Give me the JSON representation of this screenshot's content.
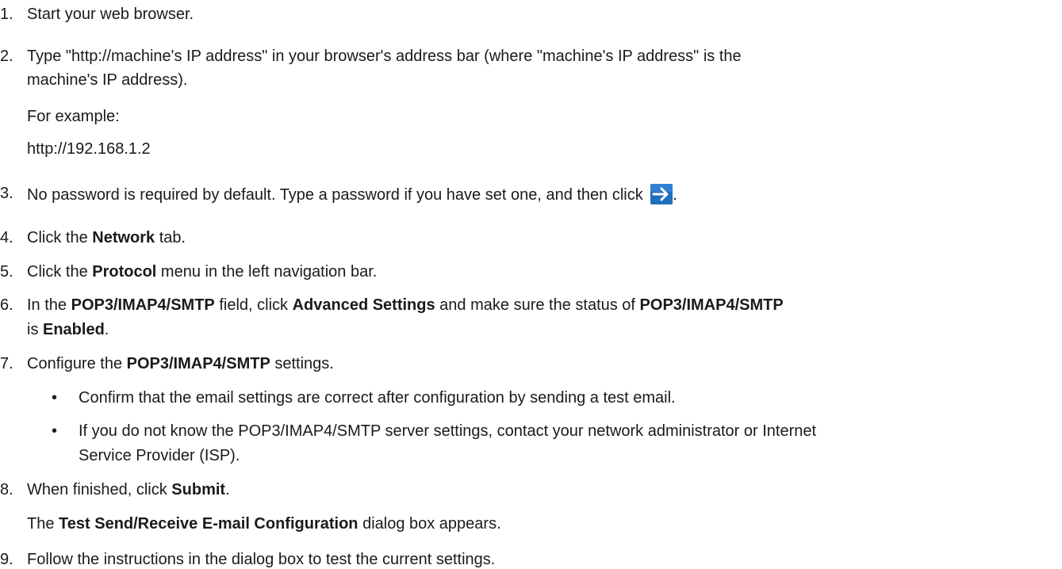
{
  "steps": [
    {
      "num": "1.",
      "text": "Start your web browser."
    },
    {
      "num": "2.",
      "line1": "Type \"http://machine's IP address\" in your browser's address bar (where \"machine's IP address\" is the",
      "line2": "machine's IP address).",
      "example_label": "For example:",
      "example_url": "http://192.168.1.2"
    },
    {
      "num": "3.",
      "text": "No password is required by default. Type a password if you have set one, and then click ",
      "after": "."
    },
    {
      "num": "4.",
      "pre": "Click the ",
      "bold": "Network",
      "post": " tab."
    },
    {
      "num": "5.",
      "pre": "Click the ",
      "bold": "Protocol",
      "post": " menu in the left navigation bar."
    },
    {
      "num": "6.",
      "pre": "In the ",
      "bold1": "POP3/IMAP4/SMTP",
      "mid1": " field, click ",
      "bold2": "Advanced Settings",
      "mid2": " and make sure the status of ",
      "bold3": "POP3/IMAP4/SMTP",
      "line2_pre": "is ",
      "line2_bold": "Enabled",
      "line2_post": "."
    },
    {
      "num": "7.",
      "pre": "Configure the ",
      "bold": "POP3/IMAP4/SMTP",
      "post": " settings.",
      "bullets": [
        {
          "line1": "Confirm that the email settings are correct after configuration by sending a test email."
        },
        {
          "line1": "If you do not know the POP3/IMAP4/SMTP server settings, contact your network administrator or Internet",
          "line2": "Service Provider (ISP)."
        }
      ]
    },
    {
      "num": "8.",
      "pre": "When finished, click ",
      "bold": "Submit",
      "post": ".",
      "note_pre": "The ",
      "note_bold": "Test Send/Receive E-mail Configuration",
      "note_post": " dialog box appears."
    },
    {
      "num": "9.",
      "text": "Follow the instructions in the dialog box to test the current settings."
    }
  ],
  "bullet_char": "•",
  "icons": {
    "submit_arrow": "arrow-right-icon"
  },
  "colors": {
    "text": "#1a1a1a",
    "arrow_bg": "#1f6fc0",
    "arrow_fg": "#ffffff"
  }
}
